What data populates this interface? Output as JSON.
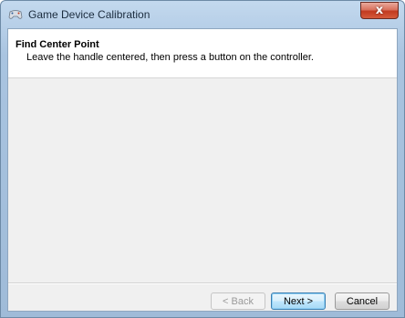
{
  "window": {
    "title": "Game Device Calibration",
    "close_label": "x"
  },
  "header": {
    "title": "Find Center Point",
    "subtitle": "Leave the handle centered, then press a button on the controller."
  },
  "buttons": {
    "back": "< Back",
    "next": "Next >",
    "cancel": "Cancel"
  },
  "icons": {
    "title_icon": "game-controller-icon",
    "close_icon": "close-icon"
  },
  "colors": {
    "close_red": "#c23a1f",
    "default_button_border": "#3c7fb1"
  }
}
